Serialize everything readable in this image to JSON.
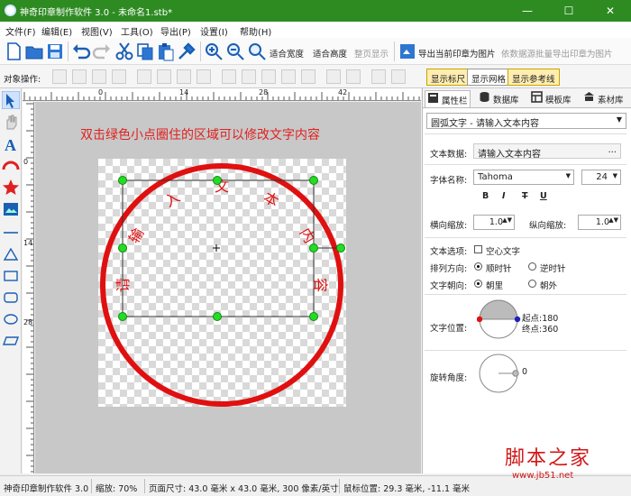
{
  "window": {
    "title": "神奇印章制作软件 3.0 - 未命名1.stb*",
    "min": "—",
    "max": "☐",
    "close": "✕"
  },
  "menu": [
    "文件(F)",
    "编辑(E)",
    "视图(V)",
    "工具(O)",
    "导出(P)",
    "设置(I)",
    "帮助(H)"
  ],
  "toolbar": {
    "fit_width": "适合宽度",
    "fit_height": "适合高度",
    "full_page": "整页显示",
    "export_current": "导出当前印章为图片",
    "batch_export": "依数据源批量导出印章为图片"
  },
  "objects_bar": {
    "label": "对象操作:",
    "show_ruler": "显示标尺",
    "show_grid": "显示网格",
    "show_guides": "显示参考线"
  },
  "ruler": {
    "h_ticks": [
      "0",
      "14",
      "28",
      "42"
    ],
    "v_ticks": [
      "0",
      "14",
      "28"
    ]
  },
  "canvas": {
    "hint": "双击绿色小点圈住的区域可以修改文字内容",
    "stamp_chars": [
      "请",
      "输",
      "入",
      "文",
      "本",
      "内",
      "容"
    ],
    "stamp_color": "#e01010"
  },
  "panel": {
    "tabs": [
      "属性栏",
      "数据库",
      "模板库",
      "素材库"
    ],
    "object_type": "圆弧文字 - 请输入文本内容",
    "text_data_label": "文本数据:",
    "text_data_value": "请输入文本内容",
    "ellipsis": "...",
    "font_label": "字体名称:",
    "font_value": "Tahoma",
    "font_size": "24",
    "style_buttons": [
      "B",
      "I",
      "T",
      "U"
    ],
    "hscale_label": "横向缩放:",
    "hscale": "1.0",
    "vscale_label": "纵向缩放:",
    "vscale": "1.0",
    "options_label": "文本选项:",
    "hollow_label": "空心文字",
    "direction_label": "排列方向:",
    "clockwise": "顺时针",
    "counter": "逆时针",
    "facing_label": "文字朝向:",
    "inward": "朝里",
    "outward": "朝外",
    "position_label": "文字位置:",
    "start_label": "起点:180",
    "end_label": "终点:360",
    "rotate_label": "旋转角度:",
    "rotate_value": "0"
  },
  "status": {
    "app": "神奇印章制作软件 3.0",
    "zoom": "缩放: 70%",
    "page_size": "页面尺寸: 43.0 毫米 x 43.0 毫米, 300 像素/英寸",
    "mouse": "鼠标位置: 29.3 毫米, -11.1 毫米"
  },
  "watermark": {
    "text": "脚本之家",
    "url": "www.jb51.net"
  }
}
